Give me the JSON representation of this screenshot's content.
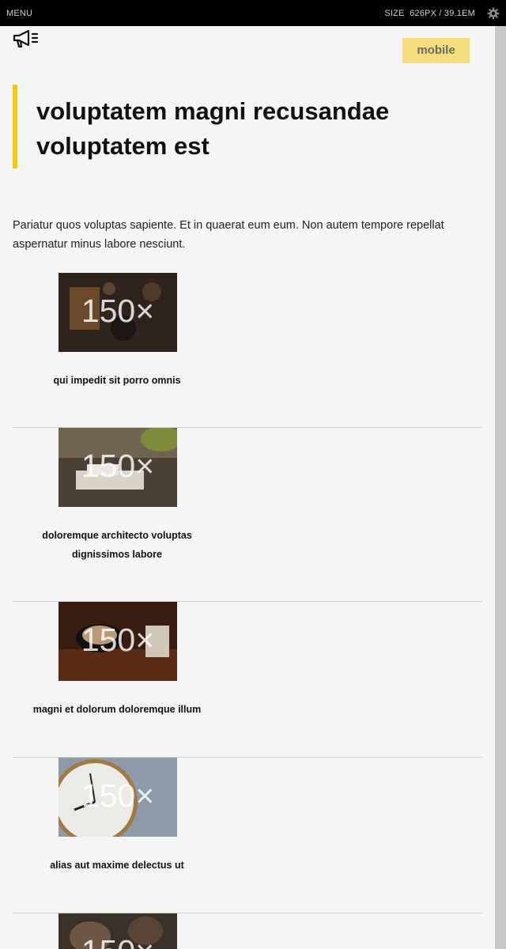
{
  "topbar": {
    "menu_label": "MENU",
    "size_label": "SIZE",
    "size_value": "626PX / 39.1EM",
    "settings_icon": "gear-icon"
  },
  "header": {
    "logo_icon": "megaphone-icon",
    "badge_label": "mobile",
    "title": "voluptatem magni recusandae voluptatem est",
    "accent_color": "#f2c811",
    "badge_color": "#f7dc7c"
  },
  "intro": "Pariatur quos voluptas sapiente. Et in quaerat eum eum. Non autem tempore repellat aspernatur minus labore nesciunt.",
  "cards": [
    {
      "placeholder": "150×",
      "title": "qui impedit sit porro omnis"
    },
    {
      "placeholder": "150×",
      "title": "doloremque architecto voluptas dignissimos labore"
    },
    {
      "placeholder": "150×",
      "title": "magni et dolorum doloremque illum"
    },
    {
      "placeholder": "150×",
      "title": "alias aut maxime delectus ut"
    },
    {
      "placeholder": "150×",
      "title": ""
    }
  ]
}
